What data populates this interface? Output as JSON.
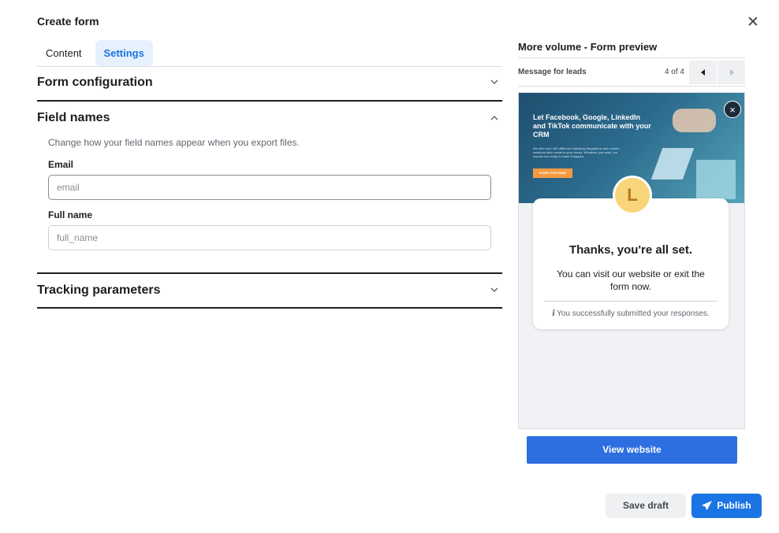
{
  "dialog": {
    "title": "Create form"
  },
  "tabs": [
    {
      "label": "Content",
      "active": false
    },
    {
      "label": "Settings",
      "active": true
    }
  ],
  "sections": {
    "form_configuration": {
      "title": "Form configuration",
      "expanded": false
    },
    "field_names": {
      "title": "Field names",
      "expanded": true,
      "description": "Change how your field names appear when you export files.",
      "fields": [
        {
          "label": "Email",
          "placeholder": "email",
          "value": ""
        },
        {
          "label": "Full name",
          "placeholder": "full_name",
          "value": ""
        }
      ]
    },
    "tracking_parameters": {
      "title": "Tracking parameters",
      "expanded": false
    }
  },
  "preview": {
    "title": "More volume - Form preview",
    "step_label": "Message for leads",
    "page_count": "4 of 4",
    "hero": {
      "headline": "Let Facebook, Google, LinkedIn and TikTok communicate with your CRM",
      "subtext": "We offer over 380 different marketing integrations and custom solutions tailor-made to your needs. Whatever you need, our experts are ready to make it happen.",
      "cta": "START FOR FREE"
    },
    "avatar_letter": "L",
    "card_title": "Thanks, you're all set.",
    "card_body": "You can visit our website or exit the form now.",
    "card_note_icon": "i",
    "card_note": "You successfully submitted your responses.",
    "view_button": "View website"
  },
  "footer": {
    "save_label": "Save draft",
    "publish_label": "Publish"
  },
  "colors": {
    "accent": "#1b74e4",
    "tab_active_bg": "#e7f0fd",
    "view_button": "#2d6fe0",
    "avatar": "#f8d57a"
  }
}
